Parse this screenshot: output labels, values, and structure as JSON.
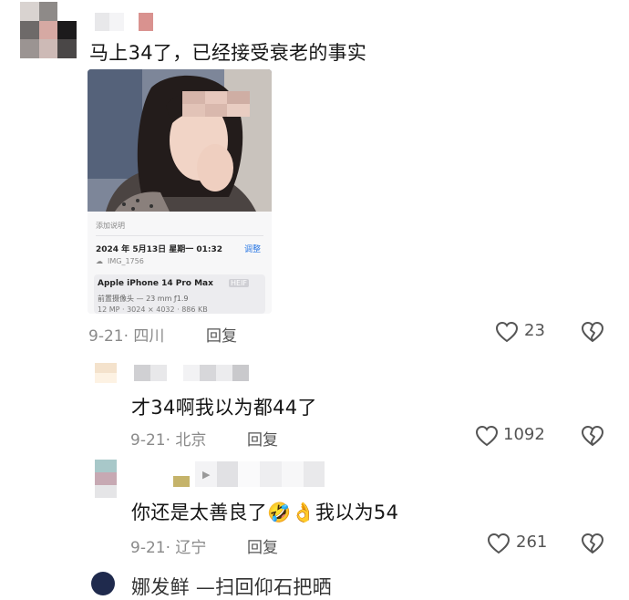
{
  "colors": {
    "text": "#161616",
    "meta": "#8a8a8a",
    "link_blue": "#2f7be5"
  },
  "comments": [
    {
      "text": "马上34了，已经接受衰老的事实",
      "time_location": "9-21· 四川",
      "reply_label": "回复",
      "likes": "23",
      "photo": {
        "caption_placeholder": "添加说明",
        "datetime": "2024 年 5月13日 星期一 01:32",
        "adjust_label": "调整",
        "filename": "IMG_1756",
        "device": "Apple iPhone 14 Pro Max",
        "format_badge": "HEIF",
        "lens": "前置摄像头 — 23 mm ƒ1.9",
        "resolution": "12 MP · 3024 × 4032 · 886 KB"
      }
    },
    {
      "text": "才34啊我以为都44了",
      "time_location": "9-21· 北京",
      "reply_label": "回复",
      "likes": "1092"
    },
    {
      "text_before": "你还是太善良了",
      "emoji_1": "🤣",
      "emoji_2": "👌",
      "text_after": "我以为54",
      "time_location": "9-21· 辽宁",
      "reply_label": "回复",
      "likes": "261"
    }
  ],
  "next_comment_partial": "娜发鲜  —扫回仰石把晒"
}
